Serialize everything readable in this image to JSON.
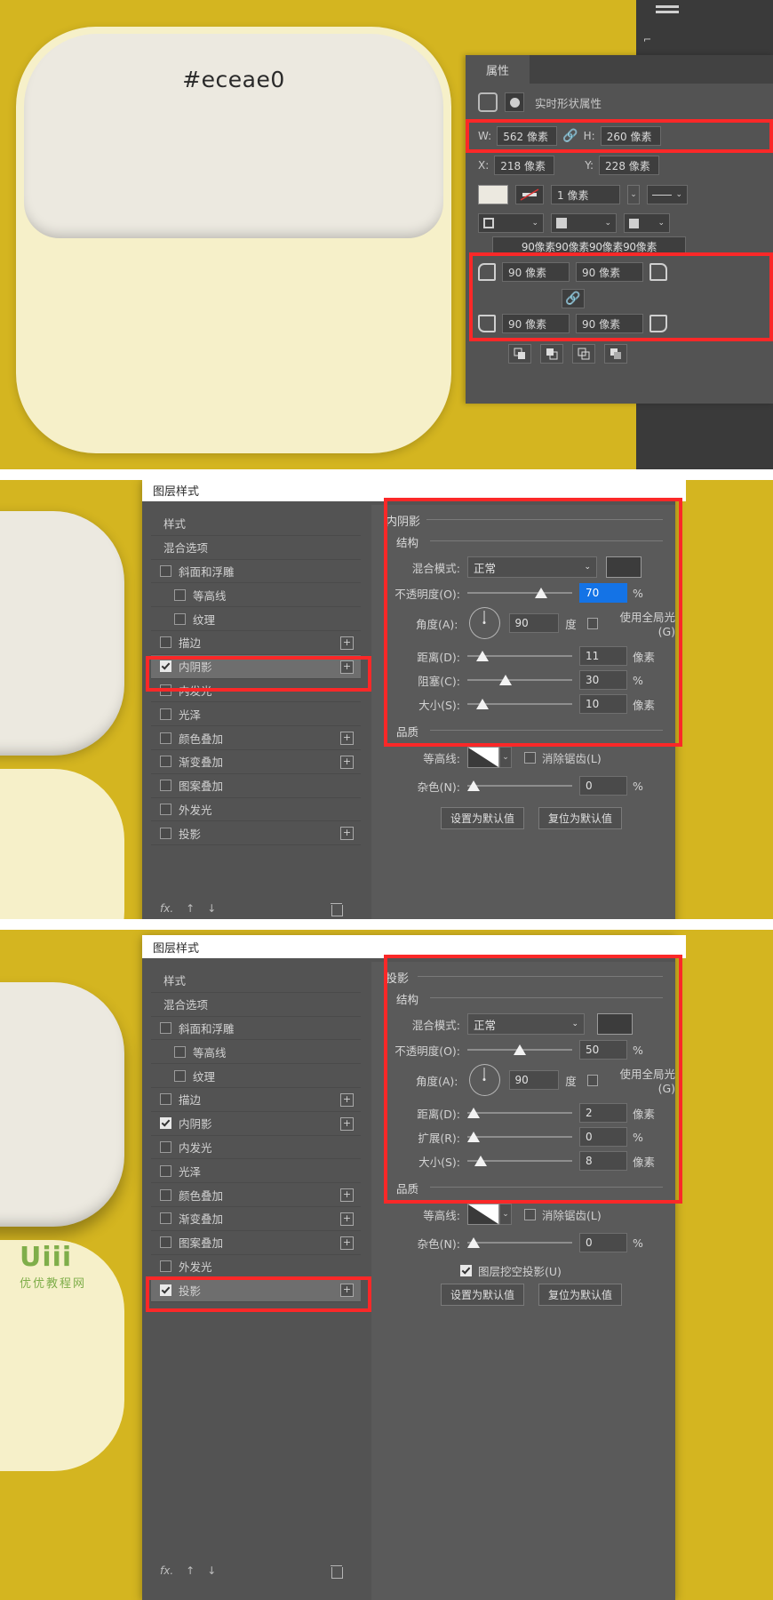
{
  "canvas": {
    "bg_color": "#d4b520",
    "card_top_color": "#eceae0",
    "card_body_color": "#f6f0c9",
    "hex_label": "#eceae0"
  },
  "properties_panel": {
    "tab_label": "属性",
    "subtitle": "实时形状属性",
    "width_label": "W:",
    "width_value": "562 像素",
    "height_label": "H:",
    "height_value": "260 像素",
    "x_label": "X:",
    "x_value": "218 像素",
    "y_label": "Y:",
    "y_value": "228 像素",
    "stroke_width": "1 像素",
    "radius_summary": "90像素90像素90像素90像素",
    "radius_tl": "90 像素",
    "radius_tr": "90 像素",
    "radius_bl": "90 像素",
    "radius_br": "90 像素",
    "link_icon": "link-icon"
  },
  "layer_style": {
    "title": "图层样式",
    "list": [
      {
        "label": "样式",
        "type": "plain",
        "checked": false,
        "plus": false,
        "selected": false
      },
      {
        "label": "混合选项",
        "type": "plain",
        "checked": false,
        "plus": false,
        "selected": false
      },
      {
        "label": "斜面和浮雕",
        "type": "check",
        "checked": false,
        "plus": false,
        "selected": false
      },
      {
        "label": "等高线",
        "type": "check",
        "checked": false,
        "plus": false,
        "selected": false,
        "indent": true
      },
      {
        "label": "纹理",
        "type": "check",
        "checked": false,
        "plus": false,
        "selected": false,
        "indent": true
      },
      {
        "label": "描边",
        "type": "check",
        "checked": false,
        "plus": true,
        "selected": false
      },
      {
        "label": "内阴影",
        "type": "check",
        "checked": true,
        "plus": true,
        "selected": true
      },
      {
        "label": "内发光",
        "type": "check",
        "checked": false,
        "plus": false,
        "selected": false
      },
      {
        "label": "光泽",
        "type": "check",
        "checked": false,
        "plus": false,
        "selected": false
      },
      {
        "label": "颜色叠加",
        "type": "check",
        "checked": false,
        "plus": true,
        "selected": false
      },
      {
        "label": "渐变叠加",
        "type": "check",
        "checked": false,
        "plus": true,
        "selected": false
      },
      {
        "label": "图案叠加",
        "type": "check",
        "checked": false,
        "plus": false,
        "selected": false
      },
      {
        "label": "外发光",
        "type": "check",
        "checked": false,
        "plus": false,
        "selected": false
      },
      {
        "label": "投影",
        "type": "check",
        "checked": false,
        "plus": true,
        "selected": false
      }
    ],
    "list2": [
      {
        "label": "样式",
        "type": "plain",
        "checked": false,
        "plus": false,
        "selected": false
      },
      {
        "label": "混合选项",
        "type": "plain",
        "checked": false,
        "plus": false,
        "selected": false
      },
      {
        "label": "斜面和浮雕",
        "type": "check",
        "checked": false,
        "plus": false,
        "selected": false
      },
      {
        "label": "等高线",
        "type": "check",
        "checked": false,
        "plus": false,
        "selected": false,
        "indent": true
      },
      {
        "label": "纹理",
        "type": "check",
        "checked": false,
        "plus": false,
        "selected": false,
        "indent": true
      },
      {
        "label": "描边",
        "type": "check",
        "checked": false,
        "plus": true,
        "selected": false
      },
      {
        "label": "内阴影",
        "type": "check",
        "checked": true,
        "plus": true,
        "selected": false
      },
      {
        "label": "内发光",
        "type": "check",
        "checked": false,
        "plus": false,
        "selected": false
      },
      {
        "label": "光泽",
        "type": "check",
        "checked": false,
        "plus": false,
        "selected": false
      },
      {
        "label": "颜色叠加",
        "type": "check",
        "checked": false,
        "plus": true,
        "selected": false
      },
      {
        "label": "渐变叠加",
        "type": "check",
        "checked": false,
        "plus": true,
        "selected": false
      },
      {
        "label": "图案叠加",
        "type": "check",
        "checked": false,
        "plus": true,
        "selected": false
      },
      {
        "label": "外发光",
        "type": "check",
        "checked": false,
        "plus": false,
        "selected": false
      },
      {
        "label": "投影",
        "type": "check",
        "checked": true,
        "plus": true,
        "selected": true
      }
    ],
    "footer": {
      "fx": "fx.",
      "up": "↑",
      "down": "↓",
      "trash": "trash-icon"
    }
  },
  "inner_shadow": {
    "group_title": "内阴影",
    "structure_title": "结构",
    "blend_mode_label": "混合模式:",
    "blend_mode_value": "正常",
    "color_swatch": "#3c3c3c",
    "opacity_label": "不透明度(O):",
    "opacity_value": "70",
    "opacity_unit": "%",
    "angle_label": "角度(A):",
    "angle_value": "90",
    "angle_unit": "度",
    "global_light_label": "使用全局光(G)",
    "global_light_checked": false,
    "distance_label": "距离(D):",
    "distance_value": "11",
    "distance_unit": "像素",
    "choke_label": "阻塞(C):",
    "choke_value": "30",
    "choke_unit": "%",
    "size_label": "大小(S):",
    "size_value": "10",
    "size_unit": "像素",
    "quality_title": "品质",
    "contour_label": "等高线:",
    "antialias_label": "消除锯齿(L)",
    "antialias_checked": false,
    "noise_label": "杂色(N):",
    "noise_value": "0",
    "noise_unit": "%",
    "set_default_btn": "设置为默认值",
    "reset_default_btn": "复位为默认值"
  },
  "drop_shadow": {
    "group_title": "投影",
    "structure_title": "结构",
    "blend_mode_label": "混合模式:",
    "blend_mode_value": "正常",
    "color_swatch": "#3c3c3c",
    "opacity_label": "不透明度(O):",
    "opacity_value": "50",
    "opacity_unit": "%",
    "angle_label": "角度(A):",
    "angle_value": "90",
    "angle_unit": "度",
    "global_light_label": "使用全局光(G)",
    "global_light_checked": false,
    "distance_label": "距离(D):",
    "distance_value": "2",
    "distance_unit": "像素",
    "spread_label": "扩展(R):",
    "spread_value": "0",
    "spread_unit": "%",
    "size_label": "大小(S):",
    "size_value": "8",
    "size_unit": "像素",
    "quality_title": "品质",
    "contour_label": "等高线:",
    "antialias_label": "消除锯齿(L)",
    "antialias_checked": false,
    "noise_label": "杂色(N):",
    "noise_value": "0",
    "noise_unit": "%",
    "knockout_label": "图层挖空投影(U)",
    "knockout_checked": true,
    "set_default_btn": "设置为默认值",
    "reset_default_btn": "复位为默认值"
  },
  "watermark": {
    "logo": "Uiii",
    "subtitle": "优优教程网",
    "color": "#7fae4a"
  }
}
